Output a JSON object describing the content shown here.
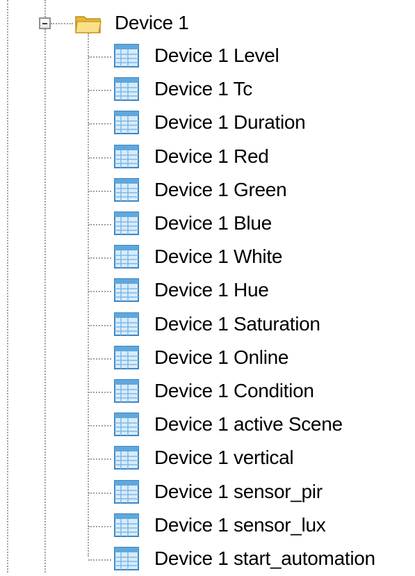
{
  "tree": {
    "root": {
      "label": "Device 1",
      "icon": "folder-open-icon",
      "expanded": true,
      "children": [
        {
          "label": "Device 1 Level",
          "icon": "table-icon"
        },
        {
          "label": "Device 1 Tc",
          "icon": "table-icon"
        },
        {
          "label": "Device 1 Duration",
          "icon": "table-icon"
        },
        {
          "label": "Device 1 Red",
          "icon": "table-icon"
        },
        {
          "label": "Device 1 Green",
          "icon": "table-icon"
        },
        {
          "label": "Device 1 Blue",
          "icon": "table-icon"
        },
        {
          "label": "Device 1 White",
          "icon": "table-icon"
        },
        {
          "label": "Device 1 Hue",
          "icon": "table-icon"
        },
        {
          "label": "Device 1 Saturation",
          "icon": "table-icon"
        },
        {
          "label": "Device 1 Online",
          "icon": "table-icon"
        },
        {
          "label": "Device 1 Condition",
          "icon": "table-icon"
        },
        {
          "label": "Device 1 active Scene",
          "icon": "table-icon"
        },
        {
          "label": "Device 1 vertical",
          "icon": "table-icon"
        },
        {
          "label": "Device 1 sensor_pir",
          "icon": "table-icon"
        },
        {
          "label": "Device 1 sensor_lux",
          "icon": "table-icon"
        },
        {
          "label": "Device 1 start_automation",
          "icon": "table-icon"
        }
      ]
    }
  },
  "colors": {
    "guide_line": "#a0a0a0",
    "folder": "#f5d36b",
    "table_header": "#5fa8dd",
    "table_body": "#d8ecfa"
  }
}
